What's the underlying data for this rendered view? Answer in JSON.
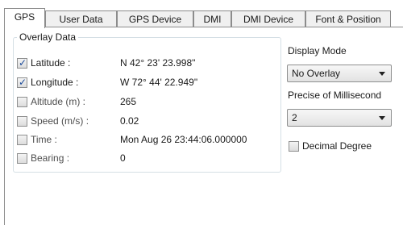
{
  "tabs": [
    {
      "label": "GPS",
      "active": true
    },
    {
      "label": "User Data"
    },
    {
      "label": "GPS Device"
    },
    {
      "label": "DMI"
    },
    {
      "label": "DMI Device"
    },
    {
      "label": "Font & Position"
    }
  ],
  "overlay": {
    "title": "Overlay Data",
    "rows": [
      {
        "label": "Latitude :",
        "value": "N 42° 23' 23.998\"",
        "checked": true
      },
      {
        "label": "Longitude :",
        "value": "W 72° 44' 22.949\"",
        "checked": true
      },
      {
        "label": "Altitude (m) :",
        "value": "265",
        "checked": false
      },
      {
        "label": "Speed (m/s) :",
        "value": "0.02",
        "checked": false
      },
      {
        "label": "Time :",
        "value": "Mon Aug 26 23:44:06.000000",
        "checked": false
      },
      {
        "label": "Bearing :",
        "value": "0",
        "checked": false
      }
    ]
  },
  "display_mode": {
    "label": "Display Mode",
    "selected": "No Overlay"
  },
  "precise": {
    "label": "Precise of Millisecond",
    "selected": "2"
  },
  "decimal_degree": {
    "label": "Decimal Degree",
    "checked": false
  },
  "icons": {
    "check": "✓",
    "dropdown": "chevron-down-icon"
  }
}
